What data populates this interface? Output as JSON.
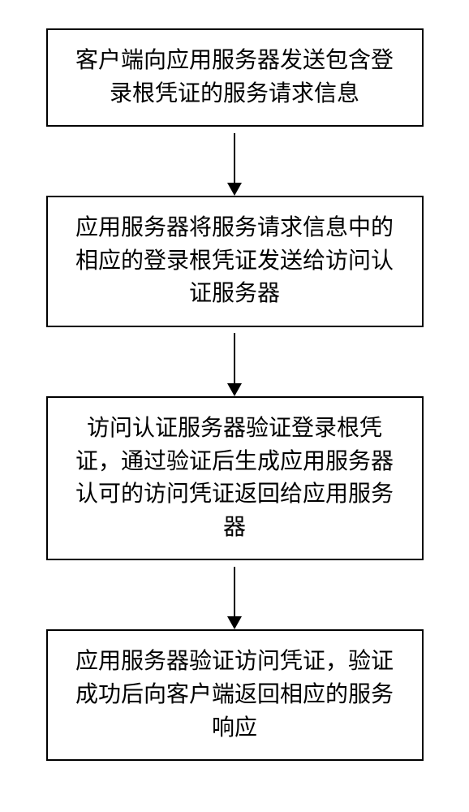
{
  "chart_data": {
    "type": "flowchart",
    "direction": "top-to-bottom",
    "steps": [
      {
        "id": "step1",
        "text": "客户端向应用服务器发送包含登录根凭证的服务请求信息"
      },
      {
        "id": "step2",
        "text": "应用服务器将服务请求信息中的相应的登录根凭证发送给访问认证服务器"
      },
      {
        "id": "step3",
        "text": "访问认证服务器验证登录根凭证，通过验证后生成应用服务器认可的访问凭证返回给应用服务器"
      },
      {
        "id": "step4",
        "text": "应用服务器验证访问凭证，验证成功后向客户端返回相应的服务响应"
      }
    ]
  }
}
